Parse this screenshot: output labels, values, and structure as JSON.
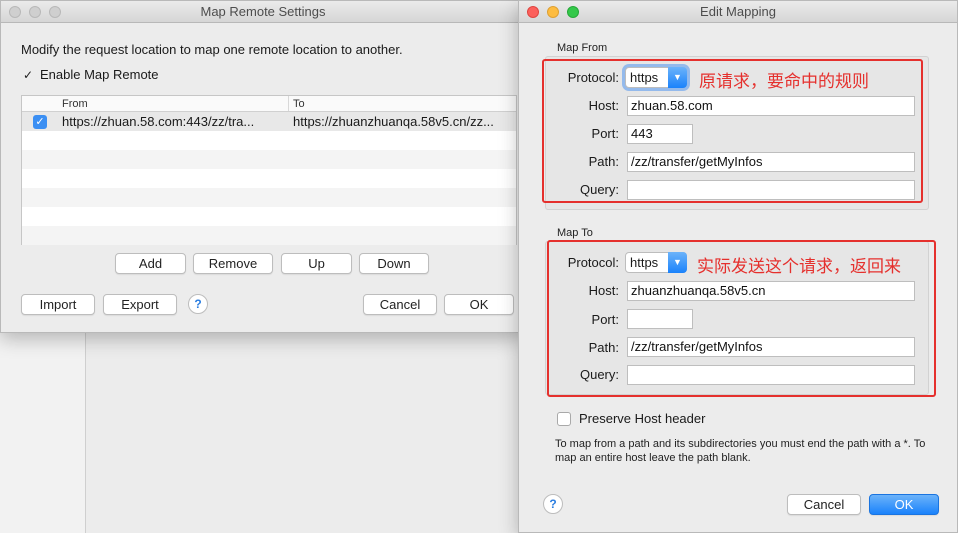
{
  "settings_window": {
    "title": "Map Remote Settings",
    "description": "Modify the request location to map one remote location to another.",
    "enable_label": "Enable Map Remote",
    "enable_checked": true,
    "table": {
      "columns": [
        "From",
        "To"
      ],
      "rows": [
        {
          "checked": true,
          "from": "https://zhuan.58.com:443/zz/tra...",
          "to": "https://zhuanzhuanqa.58v5.cn/zz..."
        }
      ]
    },
    "buttons": {
      "add": "Add",
      "remove": "Remove",
      "up": "Up",
      "down": "Down",
      "import": "Import",
      "export": "Export",
      "cancel": "Cancel",
      "ok": "OK",
      "help": "?"
    }
  },
  "edit_window": {
    "title": "Edit Mapping",
    "map_from": {
      "group_label": "Map From",
      "protocol_label": "Protocol:",
      "protocol": "https",
      "host_label": "Host:",
      "host": "zhuan.58.com",
      "port_label": "Port:",
      "port": "443",
      "path_label": "Path:",
      "path": "/zz/transfer/getMyInfos",
      "query_label": "Query:",
      "query": "",
      "annotation": "原请求，要命中的规则"
    },
    "map_to": {
      "group_label": "Map To",
      "protocol_label": "Protocol:",
      "protocol": "https",
      "host_label": "Host:",
      "host": "zhuanzhuanqa.58v5.cn",
      "port_label": "Port:",
      "port": "",
      "path_label": "Path:",
      "path": "/zz/transfer/getMyInfos",
      "query_label": "Query:",
      "query": "",
      "annotation": "实际发送这个请求，返回来"
    },
    "preserve_host_label": "Preserve Host header",
    "preserve_host_checked": false,
    "note_line1": "To map from a path and its subdirectories you must end the path with a *. To",
    "note_line2": "map an entire host leave the path blank.",
    "buttons": {
      "help": "?",
      "cancel": "Cancel",
      "ok": "OK"
    }
  },
  "colors": {
    "annotation_red": "#e5302d",
    "accent_blue": "#1a82fb"
  }
}
